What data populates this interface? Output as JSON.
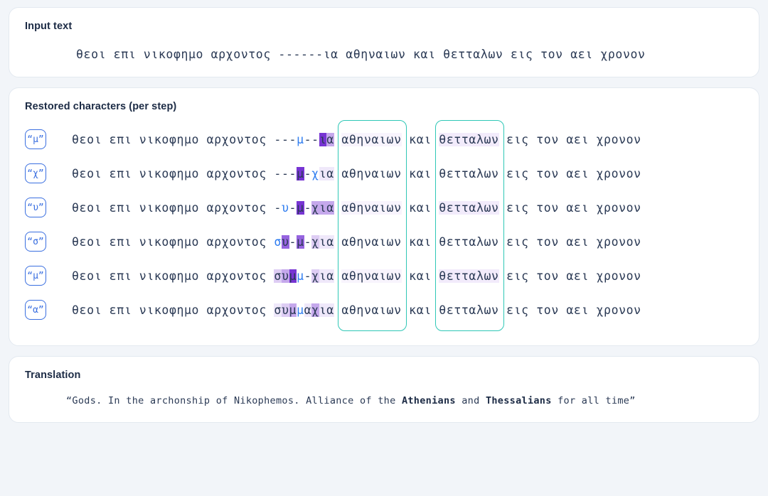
{
  "colors": {
    "page_bg": "#f2f5f9",
    "card_bg": "#ffffff",
    "text": "#2b3a55",
    "title": "#1c2b45",
    "badge_blue": "#3a6fe0",
    "new_char_blue": "#2f7df0",
    "highlight_purple": "#7f3fd4",
    "teal_box": "#2fc7b6"
  },
  "input": {
    "title": "Input text",
    "text": "θεοι επι νικοφημο αρχοντος ------ια αθηναιων και θετταλων εις τον αει χρονον"
  },
  "restored": {
    "title": "Restored characters (per step)",
    "prefix": "θεοι επι νικοφημο αρχοντος ",
    "suffix_left": " αθηναιων",
    "suffix_mid": " και ",
    "suffix_thessalian": "θετταλων",
    "suffix_right": " εις τον αει χρονον",
    "steps": [
      {
        "badge": "“μ”",
        "gap_text": "---μ--ια",
        "chars": [
          {
            "c": "-",
            "cls": "hl0"
          },
          {
            "c": "-",
            "cls": "hl0"
          },
          {
            "c": "-",
            "cls": "hl0"
          },
          {
            "c": "μ",
            "cls": "new"
          },
          {
            "c": "-",
            "cls": "hl0"
          },
          {
            "c": "-",
            "cls": "hl0"
          },
          {
            "c": "ι",
            "cls": "hl5"
          },
          {
            "c": "α",
            "cls": "hl3"
          }
        ]
      },
      {
        "badge": "“χ”",
        "gap_text": "---μ-χια",
        "chars": [
          {
            "c": "-",
            "cls": "hl0"
          },
          {
            "c": "-",
            "cls": "hl0"
          },
          {
            "c": "-",
            "cls": "hl0"
          },
          {
            "c": "μ",
            "cls": "hl5"
          },
          {
            "c": "-",
            "cls": "hl0"
          },
          {
            "c": "χ",
            "cls": "new"
          },
          {
            "c": "ι",
            "cls": "hl1"
          },
          {
            "c": "α",
            "cls": "hl1"
          }
        ]
      },
      {
        "badge": "“υ”",
        "gap_text": "-υ-μ-χια",
        "chars": [
          {
            "c": "-",
            "cls": "hl0"
          },
          {
            "c": "υ",
            "cls": "new"
          },
          {
            "c": "-",
            "cls": "hl0"
          },
          {
            "c": "μ",
            "cls": "hl5"
          },
          {
            "c": "-",
            "cls": "hl0"
          },
          {
            "c": "χ",
            "cls": "hl3"
          },
          {
            "c": "ι",
            "cls": "hl3"
          },
          {
            "c": "α",
            "cls": "hl3"
          }
        ]
      },
      {
        "badge": "“σ”",
        "gap_text": "συ-μ-χια",
        "chars": [
          {
            "c": "σ",
            "cls": "new"
          },
          {
            "c": "υ",
            "cls": "hl4"
          },
          {
            "c": "-",
            "cls": "hl0"
          },
          {
            "c": "μ",
            "cls": "hl4"
          },
          {
            "c": "-",
            "cls": "hl0"
          },
          {
            "c": "χ",
            "cls": "hl2"
          },
          {
            "c": "ι",
            "cls": "hl1"
          },
          {
            "c": "α",
            "cls": "hl1"
          }
        ]
      },
      {
        "badge": "“μ”",
        "gap_text": "συμμ-χια",
        "chars": [
          {
            "c": "σ",
            "cls": "hl2"
          },
          {
            "c": "υ",
            "cls": "hl3"
          },
          {
            "c": "μ",
            "cls": "hl5"
          },
          {
            "c": "μ",
            "cls": "new"
          },
          {
            "c": "-",
            "cls": "hl0"
          },
          {
            "c": "χ",
            "cls": "hl2"
          },
          {
            "c": "ι",
            "cls": "hl1"
          },
          {
            "c": "α",
            "cls": "hl1"
          }
        ]
      },
      {
        "badge": "“α”",
        "gap_text": "συμμαχια",
        "chars": [
          {
            "c": "σ",
            "cls": "hl1"
          },
          {
            "c": "υ",
            "cls": "hl2"
          },
          {
            "c": "μ",
            "cls": "hl3"
          },
          {
            "c": "μ",
            "cls": "new"
          },
          {
            "c": "α",
            "cls": "hl1"
          },
          {
            "c": "χ",
            "cls": "hl3"
          },
          {
            "c": "ι",
            "cls": "hl1"
          },
          {
            "c": "α",
            "cls": "hl1"
          }
        ]
      }
    ],
    "highlight_boxes": [
      {
        "label": "athenians-box",
        "word": "αθηναιων"
      },
      {
        "label": "thessalians-box",
        "word": "θετταλων"
      }
    ]
  },
  "translation": {
    "title": "Translation",
    "parts": [
      {
        "t": "“Gods. In the archonship of Nikophemos. Alliance of the ",
        "bold": false
      },
      {
        "t": "Athenians",
        "bold": true
      },
      {
        "t": " and ",
        "bold": false
      },
      {
        "t": "Thessalians",
        "bold": true
      },
      {
        "t": " for all time”",
        "bold": false
      }
    ],
    "full_text": "“Gods. In the archonship of Nikophemos. Alliance of the Athenians and Thessalians for all time”"
  }
}
